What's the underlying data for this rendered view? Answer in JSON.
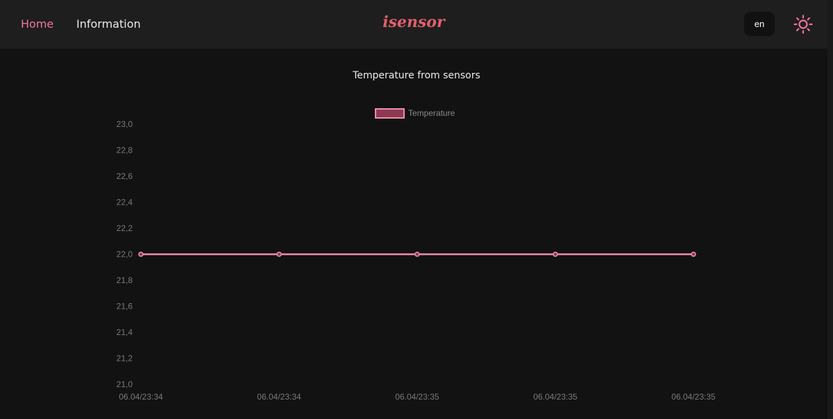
{
  "nav": {
    "home": "Home",
    "information": "Information",
    "logo": "isensor",
    "language": "en"
  },
  "colors": {
    "accent": "#f0749c",
    "logo": "#e0606c",
    "line": "#f08cb0",
    "legend_fill": "#8c3a52",
    "background": "#121212",
    "navbar": "#1e1e1e"
  },
  "icons": {
    "theme": "sun-icon"
  },
  "chart_data": {
    "type": "line",
    "title": "Temperature from sensors",
    "xlabel": "",
    "ylabel": "",
    "legend_position": "top-center",
    "grid": false,
    "ylim": [
      21.0,
      23.0
    ],
    "y_ticks": [
      "23,0",
      "22,8",
      "22,6",
      "22,4",
      "22,2",
      "22,0",
      "21,8",
      "21,6",
      "21,4",
      "21,2",
      "21,0"
    ],
    "x": [
      "06.04/23:34",
      "06.04/23:34",
      "06.04/23:35",
      "06.04/23:35",
      "06.04/23:35"
    ],
    "series": [
      {
        "name": "Temperature",
        "values": [
          22.0,
          22.0,
          22.0,
          22.0,
          22.0
        ]
      }
    ]
  }
}
